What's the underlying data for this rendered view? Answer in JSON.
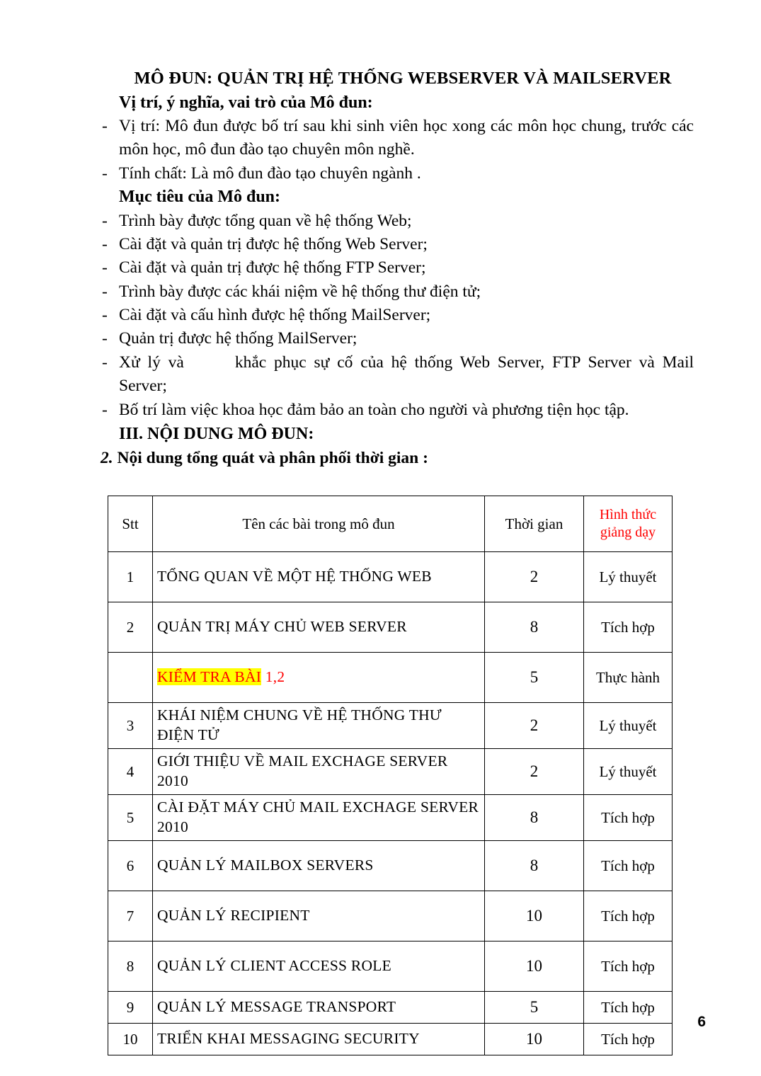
{
  "document": {
    "title": "MÔ ĐUN: QUẢN TRỊ HỆ THỐNG WEBSERVER VÀ MAILSERVER",
    "page_number": "6"
  },
  "sections": {
    "position_heading": "Vị trí, ý nghĩa, vai trò của Mô đun:",
    "position_items": [
      "Vị trí: Mô đun được bố trí sau khi sinh viên học xong các môn học chung, trước các môn học, mô đun đào tạo chuyên môn nghề.",
      "Tính chất: Là mô đun đào tạo chuyên ngành ."
    ],
    "objective_heading": "Mục tiêu của Mô đun:",
    "objective_items": [
      "Trình bày được tổng quan về hệ thống Web;",
      "Cài đặt và quản trị được hệ thống Web Server;",
      "Cài đặt và quản trị được hệ thống FTP Server;",
      "Trình bày được các khái niệm về hệ thống thư điện tử;",
      "Cài đặt và cấu hình được hệ thống MailServer;",
      "Quản trị được hệ thống MailServer;",
      "Bố trí làm việc khoa học đảm bảo an toàn cho người và phương tiện học tập."
    ],
    "troubleshoot_item": {
      "before_gap": "Xử lý và",
      "after_gap": "khắc phục sự cố của hệ thống Web Server, FTP Server và Mail Server;"
    },
    "content_heading": "III. NỘI DUNG MÔ ĐUN:",
    "content_subheading_number": "2.",
    "content_subheading_text": "Nội dung tổng quát và phân phối thời gian :"
  },
  "table": {
    "columns": [
      "Stt",
      "Tên các bài trong mô đun",
      "Thời gian",
      "Hình thức giảng dạy"
    ],
    "header_form_line1": "Hình thức",
    "header_form_line2": "giảng dạy",
    "header_form_color": "#ff0000",
    "highlight_color": "#ffff00",
    "rows": [
      {
        "stt": "1",
        "name": "TỔNG QUAN VỀ MỘT HỆ THỐNG WEB",
        "time": "2",
        "form": "Lý thuyết"
      },
      {
        "stt": "2",
        "name": "QUẢN TRỊ MÁY CHỦ WEB SERVER",
        "time": "8",
        "form": "Tích hợp"
      },
      {
        "stt": "",
        "name_highlight": "KIỂM TRA BÀI",
        "name_suffix": "1,2",
        "time": "5",
        "form": "Thực hành"
      },
      {
        "stt": "3",
        "name": "KHÁI NIỆM CHUNG VỀ HỆ THỐNG THƯ ĐIỆN TỬ",
        "time": "2",
        "form": "Lý thuyết"
      },
      {
        "stt": "4",
        "name": "GIỚI THIỆU VỀ MAIL EXCHAGE SERVER 2010",
        "time": "2",
        "form": "Lý thuyết"
      },
      {
        "stt": "5",
        "name": "CÀI ĐẶT MÁY CHỦ MAIL EXCHAGE SERVER 2010",
        "time": "8",
        "form": "Tích hợp"
      },
      {
        "stt": "6",
        "name": "QUẢN LÝ MAILBOX SERVERS",
        "time": "8",
        "form": "Tích hợp"
      },
      {
        "stt": "7",
        "name": "QUẢN LÝ RECIPIENT",
        "time": "10",
        "form": "Tích hợp"
      },
      {
        "stt": "8",
        "name": "QUẢN LÝ CLIENT ACCESS ROLE",
        "time": "10",
        "form": "Tích hợp"
      },
      {
        "stt": "9",
        "name": "QUẢN LÝ MESSAGE TRANSPORT",
        "time": "5",
        "form": "Tích hợp"
      },
      {
        "stt": "10",
        "name": "TRIỂN KHAI MESSAGING SECURITY",
        "time": "10",
        "form": "Tích hợp"
      }
    ]
  }
}
